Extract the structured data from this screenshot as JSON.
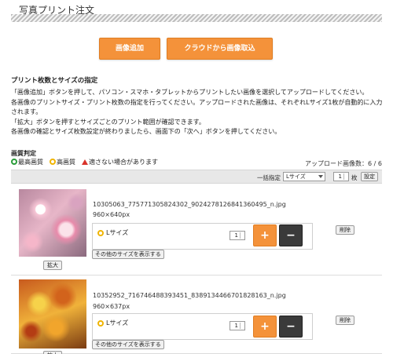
{
  "page": {
    "title": "写真プリント注文"
  },
  "actions": {
    "add_image": "画像追加",
    "cloud_import": "クラウドから画像取込"
  },
  "instructions": {
    "heading": "プリント枚数とサイズの指定",
    "lines": [
      "「画像追加」ボタンを押して、パソコン・スマホ・タブレットからプリントしたい画像を選択してアップロードしてください。",
      "各画像のプリントサイズ・プリント枚数の指定を行ってください。アップロードされた画像は、それぞれLサイズ1枚が自動的に入力されます。",
      "「拡大」ボタンを押すとサイズごとのプリント範囲が確認できます。",
      "各画像の確認とサイズ枚数設定が終わりましたら、画面下の「次へ」ボタンを押してください。"
    ]
  },
  "judgement": {
    "title": "画質判定",
    "best": "最高画質",
    "high": "高画質",
    "warning": "適さない場合があります",
    "colors": {
      "best": "#2a9d3a",
      "high": "#f0b400",
      "warning": "#d9332b"
    }
  },
  "upload_count": "アップロード画像数：6 / 6",
  "batch": {
    "label": "一括指定",
    "size_value": "Lサイズ",
    "qty_value": "1",
    "unit": "枚",
    "set_label": "設定"
  },
  "items": [
    {
      "filename": "10305063_775771305824302_9024278126841360495_n.jpg",
      "dims": "960×640px",
      "size": "Lサイズ",
      "qty": "1",
      "zoom": "拡大",
      "other_sizes": "その他のサイズを表示する",
      "delete": "削除",
      "plus": "+",
      "minus": "−"
    },
    {
      "filename": "10352952_716746488393451_8389134466701828163_n.jpg",
      "dims": "960×637px",
      "size": "Lサイズ",
      "qty": "1",
      "zoom": "拡大",
      "other_sizes": "その他のサイズを表示する",
      "delete": "削除",
      "plus": "+",
      "minus": "−"
    }
  ],
  "colors": {
    "accent": "#f4923a",
    "dark_button": "#3a3a3a"
  }
}
